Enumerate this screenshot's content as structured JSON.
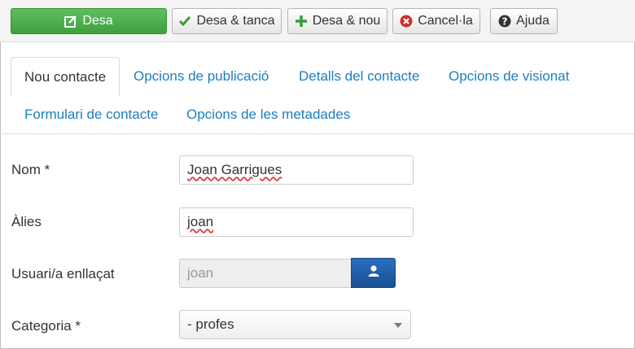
{
  "toolbar": {
    "save": "Desa",
    "save_close": "Desa & tanca",
    "save_new": "Desa & nou",
    "cancel": "Cancel·la",
    "help": "Ajuda"
  },
  "tabs": [
    {
      "label": "Nou contacte",
      "active": true
    },
    {
      "label": "Opcions de publicació"
    },
    {
      "label": "Detalls del contacte"
    },
    {
      "label": "Opcions de visionat"
    },
    {
      "label": "Formulari de contacte"
    },
    {
      "label": "Opcions de les metadades"
    }
  ],
  "form": {
    "name_label": "Nom *",
    "name_value": "Joan Garrigues",
    "alias_label": "Àlies",
    "alias_value": "joan",
    "user_label": "Usuari/a enllaçat",
    "user_value": "joan",
    "category_label": "Categoria *",
    "category_value": "- profes"
  },
  "icons": {
    "save": "edit-icon",
    "save_close": "check-icon",
    "save_new": "plus-icon",
    "cancel": "cancel-circle-icon",
    "help": "question-circle-icon",
    "user_select": "user-icon"
  },
  "colors": {
    "save_button": "#4cae4c",
    "link": "#1d7ec0",
    "user_button": "#205da8",
    "check_green": "#3a9a3a",
    "cancel_red": "#c9302c"
  }
}
